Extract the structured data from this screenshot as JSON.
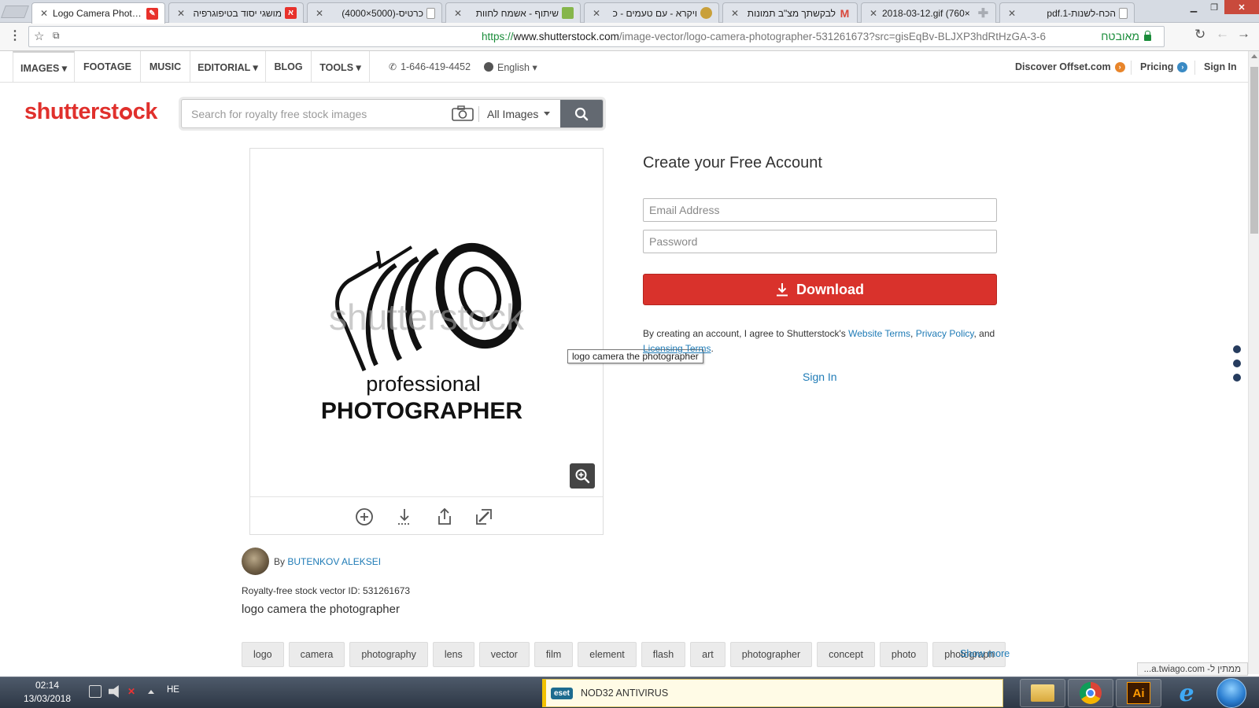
{
  "browser": {
    "tabs": [
      {
        "title": "Logo Camera Photographer",
        "active": true,
        "favicon_color": "#e8312b"
      },
      {
        "title": "מושגי יסוד בטיפוגרפיה",
        "active": false,
        "favicon_color": "#e8312b"
      },
      {
        "title": "כרטיס-(5000×4000)",
        "active": false,
        "favicon_color": "#9aa0a8"
      },
      {
        "title": "שיתוף - אשמח לחוות",
        "active": false,
        "favicon_color": "#86b64b"
      },
      {
        "title": "ויקרא - עם טעמים - כ",
        "active": false,
        "favicon_color": "#c9a03a"
      },
      {
        "title": "לבקשתך מצ\"ב תמונות",
        "active": false,
        "favicon_color": "#d9473b"
      },
      {
        "title": "2018-03-12.gif (760×",
        "active": false,
        "favicon_color": "#a8acb3"
      },
      {
        "title": "הכח-לשנות-1.pdf",
        "active": false,
        "favicon_color": "#9aa0a8"
      }
    ],
    "url_protocol": "https://",
    "url_host": "www.shutterstock.com",
    "url_path": "/image-vector/logo-camera-photographer-531261673?src=gisEqBv-BLJXP3hdRtHzGA-3-6",
    "secure_label": "מאובטח",
    "status_url": "ממתין ל- a.twiago.com..."
  },
  "site_nav": {
    "items": [
      {
        "label": "IMAGES ▾"
      },
      {
        "label": "FOOTAGE"
      },
      {
        "label": "MUSIC"
      },
      {
        "label": "EDITORIAL ▾"
      },
      {
        "label": "BLOG"
      },
      {
        "label": "TOOLS ▾"
      }
    ],
    "phone": "1-646-419-4452",
    "language": "English ▾",
    "discover": "Discover Offset.com",
    "pricing": "Pricing",
    "sign_in": "Sign In",
    "discover_color": "#e8852a",
    "pricing_color": "#3a8ac4"
  },
  "logo": {
    "text_a": "shutterst",
    "text_b": "ck",
    "brand_color": "#e0302c"
  },
  "search": {
    "placeholder": "Search for royalty free stock images",
    "value": "",
    "category": "All Images"
  },
  "preview": {
    "watermark": "shutterstock",
    "line1": "professional",
    "line2": "PHOTOGRAPHER",
    "tooltip": "logo camera the photographer"
  },
  "account_form": {
    "title": "Create your Free Account",
    "email_placeholder": "Email Address",
    "password_placeholder": "Password",
    "download_label": "Download",
    "terms_prefix": "By creating an account, I agree to Shutterstock's",
    "terms_link1": "Website Terms",
    "terms_sep1": ",",
    "terms_link2": "Privacy Policy",
    "terms_sep2": ", and",
    "terms_link3": "Licensing Terms",
    "terms_end": ".",
    "sign_in": "Sign In",
    "accent": "#d9322c",
    "link_color": "#1f7bb6"
  },
  "details": {
    "by_label": "By",
    "author": "BUTENKOV ALEKSEI",
    "image_id": "Royalty-free stock vector ID: 531261673",
    "description": "logo camera the photographer",
    "keywords": [
      "logo",
      "camera",
      "photography",
      "lens",
      "vector",
      "film",
      "element",
      "flash",
      "art",
      "photographer",
      "concept",
      "photo",
      "photograph"
    ],
    "show_more": "Show more"
  },
  "taskbar": {
    "time": "02:14",
    "date": "13/03/2018",
    "language": "HE",
    "notification_brand": "eset",
    "notification_text": "NOD32 ANTIVIRUS"
  }
}
